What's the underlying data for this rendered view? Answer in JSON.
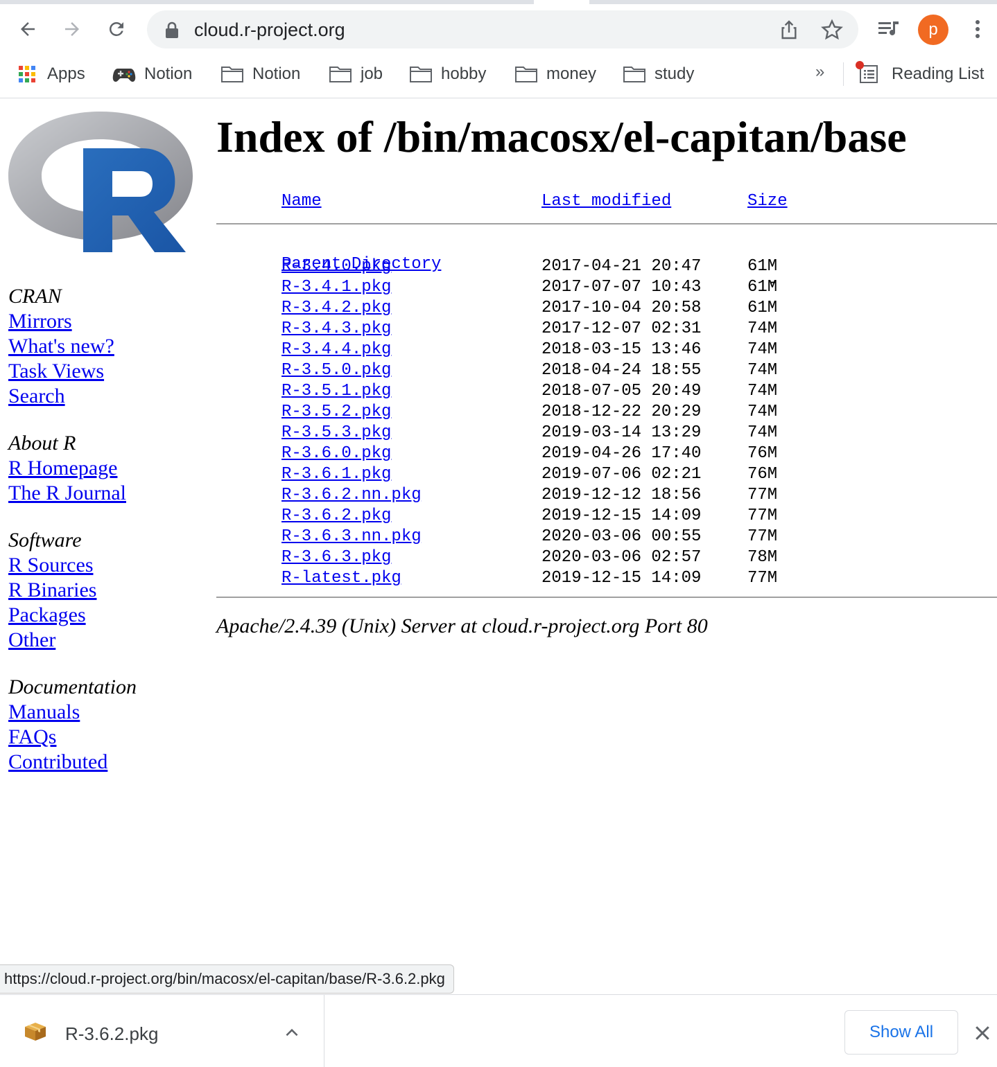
{
  "browser": {
    "url": "cloud.r-project.org",
    "avatar_letter": "p",
    "accent_color": "#f16a22",
    "bookmarks": [
      {
        "label": "Apps",
        "icon": "apps-grid-icon"
      },
      {
        "label": "Notion",
        "icon": "gamepad-icon"
      },
      {
        "label": "Notion",
        "icon": "folder-icon"
      },
      {
        "label": "job",
        "icon": "folder-icon"
      },
      {
        "label": "hobby",
        "icon": "folder-icon"
      },
      {
        "label": "money",
        "icon": "folder-icon"
      },
      {
        "label": "study",
        "icon": "folder-icon"
      }
    ],
    "more_bookmarks": "»",
    "reading_list": "Reading List"
  },
  "sidebar": {
    "groups": [
      {
        "heading": "CRAN",
        "links": [
          "Mirrors",
          "What's new?",
          "Task Views",
          "Search"
        ]
      },
      {
        "heading": "About R",
        "links": [
          "R Homepage",
          "The R Journal"
        ]
      },
      {
        "heading": "Software",
        "links": [
          "R Sources",
          "R Binaries",
          "Packages",
          "Other"
        ]
      },
      {
        "heading": "Documentation",
        "links": [
          "Manuals",
          "FAQs",
          "Contributed"
        ]
      }
    ]
  },
  "main": {
    "title": "Index of /bin/macosx/el-capitan/base",
    "columns": {
      "name": "Name",
      "last_modified": "Last modified",
      "size": "Size"
    },
    "parent": {
      "name": "Parent Directory",
      "size": "-"
    },
    "files": [
      {
        "name": "R-3.4.0.pkg",
        "date": "2017-04-21 20:47",
        "size": "61M"
      },
      {
        "name": "R-3.4.1.pkg",
        "date": "2017-07-07 10:43",
        "size": "61M"
      },
      {
        "name": "R-3.4.2.pkg",
        "date": "2017-10-04 20:58",
        "size": "61M"
      },
      {
        "name": "R-3.4.3.pkg",
        "date": "2017-12-07 02:31",
        "size": "74M"
      },
      {
        "name": "R-3.4.4.pkg",
        "date": "2018-03-15 13:46",
        "size": "74M"
      },
      {
        "name": "R-3.5.0.pkg",
        "date": "2018-04-24 18:55",
        "size": "74M"
      },
      {
        "name": "R-3.5.1.pkg",
        "date": "2018-07-05 20:49",
        "size": "74M"
      },
      {
        "name": "R-3.5.2.pkg",
        "date": "2018-12-22 20:29",
        "size": "74M"
      },
      {
        "name": "R-3.5.3.pkg",
        "date": "2019-03-14 13:29",
        "size": "74M"
      },
      {
        "name": "R-3.6.0.pkg",
        "date": "2019-04-26 17:40",
        "size": "76M"
      },
      {
        "name": "R-3.6.1.pkg",
        "date": "2019-07-06 02:21",
        "size": "76M"
      },
      {
        "name": "R-3.6.2.nn.pkg",
        "date": "2019-12-12 18:56",
        "size": "77M"
      },
      {
        "name": "R-3.6.2.pkg",
        "date": "2019-12-15 14:09",
        "size": "77M"
      },
      {
        "name": "R-3.6.3.nn.pkg",
        "date": "2020-03-06 00:55",
        "size": "77M"
      },
      {
        "name": "R-3.6.3.pkg",
        "date": "2020-03-06 02:57",
        "size": "78M"
      },
      {
        "name": "R-latest.pkg",
        "date": "2019-12-15 14:09",
        "size": "77M"
      }
    ],
    "address": "Apache/2.4.39 (Unix) Server at cloud.r-project.org Port 80"
  },
  "status_url": "https://cloud.r-project.org/bin/macosx/el-capitan/base/R-3.6.2.pkg",
  "downloads": {
    "file": "R-3.6.2.pkg",
    "show_all": "Show All"
  }
}
